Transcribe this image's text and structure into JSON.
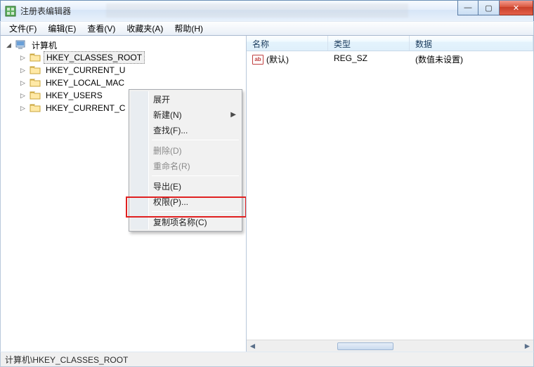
{
  "window": {
    "title": "注册表编辑器",
    "buttons": {
      "min": "—",
      "max": "▢",
      "close": "✕"
    }
  },
  "menubar": {
    "file": "文件(F)",
    "edit": "编辑(E)",
    "view": "查看(V)",
    "favorites": "收藏夹(A)",
    "help": "帮助(H)"
  },
  "tree": {
    "root": "计算机",
    "keys": [
      "HKEY_CLASSES_ROOT",
      "HKEY_CURRENT_USER",
      "HKEY_LOCAL_MACHINE",
      "HKEY_USERS",
      "HKEY_CURRENT_CONFIG"
    ],
    "keys_truncated": [
      "HKEY_CLASSES_ROOT",
      "HKEY_CURRENT_U",
      "HKEY_LOCAL_MAC",
      "HKEY_USERS",
      "HKEY_CURRENT_C"
    ],
    "selected_index": 0
  },
  "list": {
    "columns": {
      "name": "名称",
      "type": "类型",
      "data": "数据"
    },
    "rows": [
      {
        "icon": "ab",
        "name": "(默认)",
        "type": "REG_SZ",
        "data": "(数值未设置)"
      }
    ]
  },
  "context_menu": {
    "items": [
      {
        "label": "展开",
        "enabled": true,
        "submenu": false
      },
      {
        "label": "新建(N)",
        "enabled": true,
        "submenu": true
      },
      {
        "label": "查找(F)...",
        "enabled": true,
        "submenu": false
      },
      {
        "sep": true
      },
      {
        "label": "删除(D)",
        "enabled": false,
        "submenu": false
      },
      {
        "label": "重命名(R)",
        "enabled": false,
        "submenu": false
      },
      {
        "sep": true
      },
      {
        "label": "导出(E)",
        "enabled": true,
        "submenu": false
      },
      {
        "label": "权限(P)...",
        "enabled": true,
        "submenu": false,
        "highlighted": true
      },
      {
        "sep": true
      },
      {
        "label": "复制项名称(C)",
        "enabled": true,
        "submenu": false
      }
    ]
  },
  "statusbar": {
    "path": "计算机\\HKEY_CLASSES_ROOT"
  },
  "colors": {
    "accent": "#3a6ea5",
    "highlight_red": "#e02020"
  }
}
